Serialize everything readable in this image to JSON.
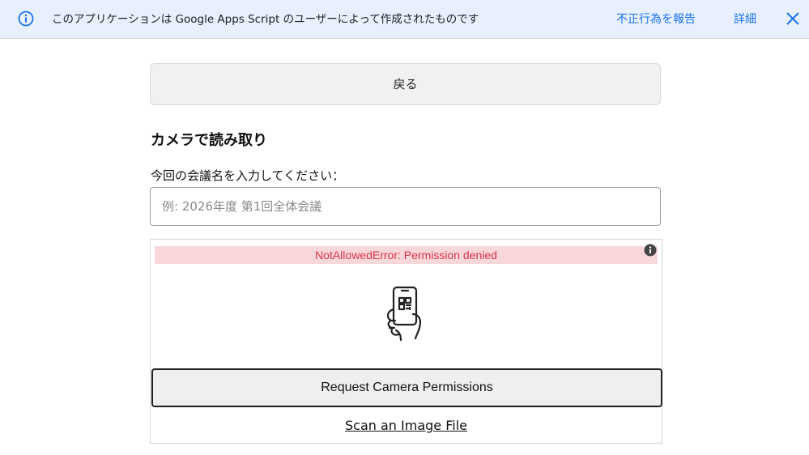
{
  "banner": {
    "info_icon": "info-icon",
    "message": "このアプリケーションは Google Apps Script のユーザーによって作成されたものです",
    "report_label": "不正行為を報告",
    "details_label": "詳細",
    "close_icon": "close-icon",
    "link_color": "#1a73e8",
    "background_color": "#e8f0fe"
  },
  "main": {
    "back_label": "戻る",
    "section_title": "カメラで読み取り",
    "meeting_field": {
      "label": "今回の会議名を入力してください：",
      "placeholder": "例: 2026年度 第1回全体会議",
      "value": ""
    }
  },
  "scanner": {
    "error_message": "NotAllowedError: Permission denied",
    "error_color": "#dc3545",
    "error_background": "#f8d7da",
    "info_icon": "info-dot-icon",
    "graphic_icon": "phone-qr-scan-icon",
    "request_permission_label": "Request Camera Permissions",
    "scan_file_label": "Scan an Image File"
  }
}
